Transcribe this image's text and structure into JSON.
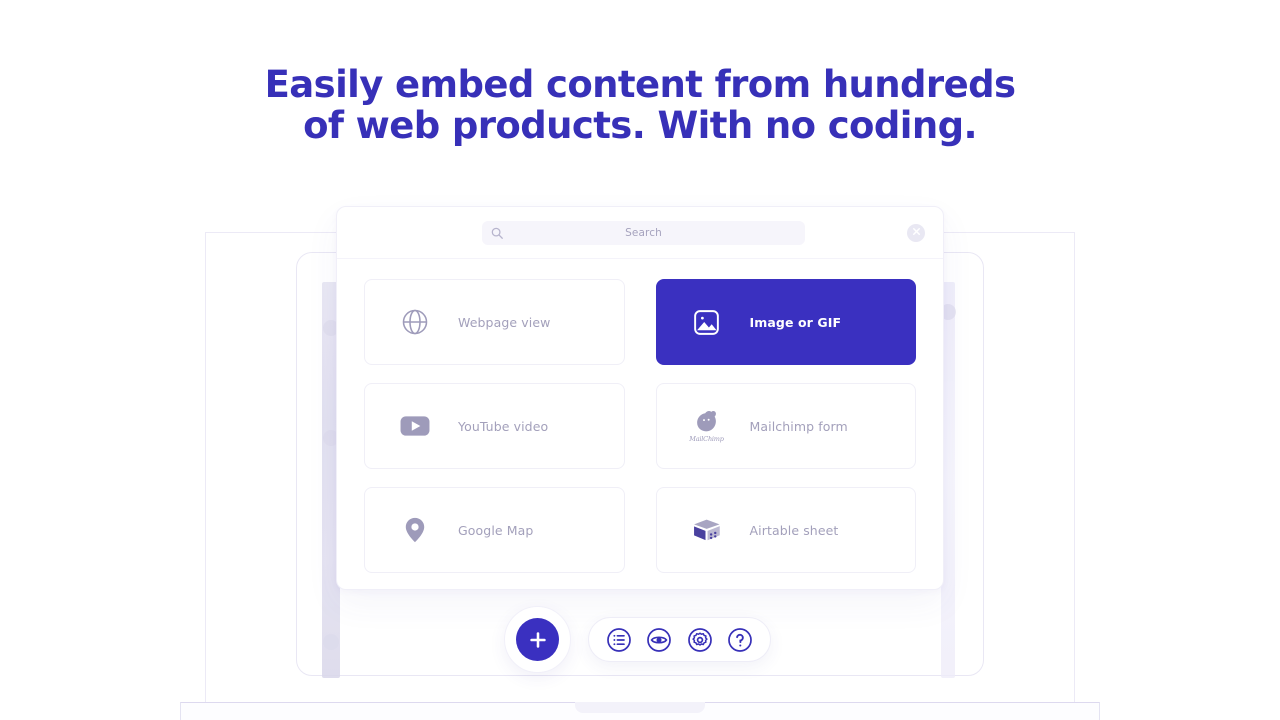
{
  "headline": {
    "line1": "Easily embed content from hundreds",
    "line2": "of web products. With no coding.",
    "color": "#3730b8"
  },
  "app": {
    "search": {
      "icon": "search-icon",
      "placeholder": "Search",
      "value": ""
    },
    "close_button": {
      "icon": "close-icon",
      "label": "×"
    },
    "accent_color": "#3a30c0",
    "muted_text_color": "#a3a0bb",
    "cards": [
      {
        "label": "Webpage view",
        "icon": "globe-icon",
        "selected": false
      },
      {
        "label": "Image or GIF",
        "icon": "image-icon",
        "selected": true
      },
      {
        "label": "YouTube video",
        "icon": "youtube-icon",
        "selected": false
      },
      {
        "label": "Mailchimp form",
        "icon": "mailchimp-icon",
        "selected": false,
        "wordmark": "MailChimp"
      },
      {
        "label": "Google Map",
        "icon": "map-pin-icon",
        "selected": false
      },
      {
        "label": "Airtable sheet",
        "icon": "airtable-icon",
        "selected": false
      }
    ]
  },
  "toolbar": {
    "add_button": {
      "icon": "plus-icon",
      "label": "+"
    },
    "items": [
      {
        "icon": "list-icon",
        "name": "list"
      },
      {
        "icon": "eye-icon",
        "name": "preview"
      },
      {
        "icon": "gear-icon",
        "name": "settings"
      },
      {
        "icon": "question-icon",
        "name": "help"
      }
    ]
  }
}
